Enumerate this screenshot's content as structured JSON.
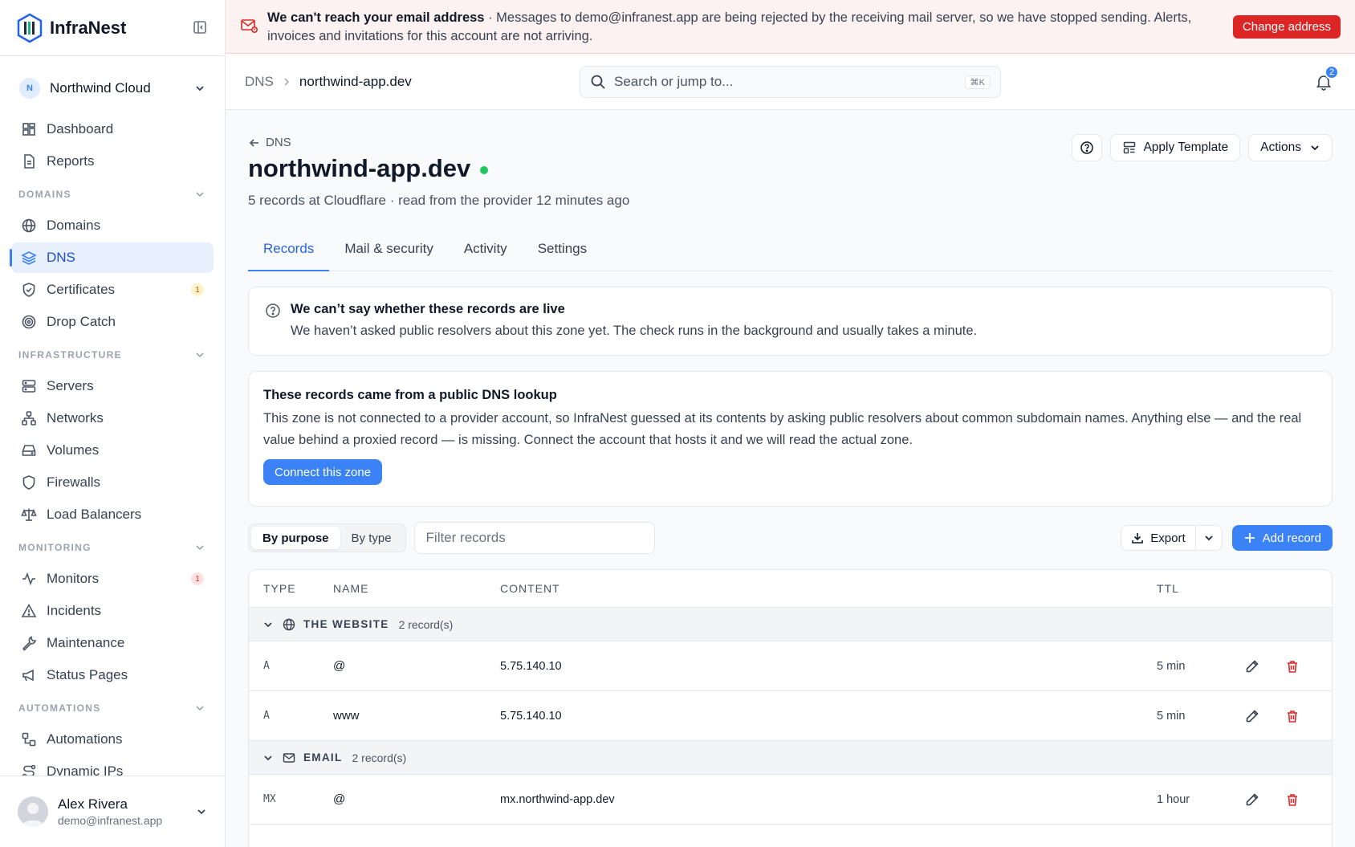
{
  "brand": {
    "name": "InfraNest"
  },
  "org": {
    "initial": "N",
    "name": "Northwind Cloud"
  },
  "sidebar": {
    "top_items": [
      {
        "label": "Dashboard"
      },
      {
        "label": "Reports"
      }
    ],
    "sections": [
      {
        "title": "DOMAINS",
        "items": [
          {
            "label": "Domains"
          },
          {
            "label": "DNS",
            "active": true
          },
          {
            "label": "Certificates",
            "badge": "1"
          },
          {
            "label": "Drop Catch"
          }
        ]
      },
      {
        "title": "INFRASTRUCTURE",
        "items": [
          {
            "label": "Servers"
          },
          {
            "label": "Networks"
          },
          {
            "label": "Volumes"
          },
          {
            "label": "Firewalls"
          },
          {
            "label": "Load Balancers"
          }
        ]
      },
      {
        "title": "MONITORING",
        "items": [
          {
            "label": "Monitors",
            "badge": "1"
          },
          {
            "label": "Incidents"
          },
          {
            "label": "Maintenance"
          },
          {
            "label": "Status Pages"
          }
        ]
      },
      {
        "title": "AUTOMATIONS",
        "items": [
          {
            "label": "Automations"
          },
          {
            "label": "Dynamic IPs"
          }
        ]
      }
    ]
  },
  "user": {
    "name": "Alex Rivera",
    "email": "demo@infranest.app"
  },
  "banner": {
    "title": "We can't reach your email address",
    "separator": " · ",
    "message": "Messages to demo@infranest.app are being rejected by the receiving mail server, so we have stopped sending. Alerts, invoices and invitations for this account are not arriving.",
    "button": "Change address",
    "color": "#dc2626"
  },
  "topbar": {
    "breadcrumb_root": "DNS",
    "breadcrumb_current": "northwind-app.dev",
    "search_placeholder": "Search or jump to...",
    "search_shortcut": "⌘K",
    "notifications": "2"
  },
  "page": {
    "back_label": "DNS",
    "title": "northwind-app.dev",
    "subtitle": "5 records at Cloudflare · read from the provider 12 minutes ago",
    "apply_template": "Apply Template",
    "actions": "Actions",
    "status_color": "#22c55e"
  },
  "tabs": [
    {
      "label": "Records",
      "active": true
    },
    {
      "label": "Mail & security"
    },
    {
      "label": "Activity"
    },
    {
      "label": "Settings"
    }
  ],
  "live_notice": {
    "title": "We can’t say whether these records are live",
    "text": "We haven’t asked public resolvers about this zone yet. The check runs in the background and usually takes a minute."
  },
  "lookup_notice": {
    "title": "These records came from a public DNS lookup",
    "text": "This zone is not connected to a provider account, so InfraNest guessed at its contents by asking public resolvers about common subdomain names. Anything else — and the real value behind a proxied record — is missing. Connect the account that hosts it and we will read the actual zone.",
    "button": "Connect this zone"
  },
  "toolbar": {
    "view_purpose": "By purpose",
    "view_type": "By type",
    "filter_placeholder": "Filter records",
    "export": "Export",
    "add": "Add record",
    "accent": "#3b82f6"
  },
  "table": {
    "headers": {
      "type": "TYPE",
      "name": "NAME",
      "content": "CONTENT",
      "ttl": "TTL"
    },
    "groups": [
      {
        "label": "THE WEBSITE",
        "count": "2 record(s)",
        "icon": "globe-icon",
        "records": [
          {
            "type": "A",
            "name": "@",
            "content": "5.75.140.10",
            "ttl": "5 min"
          },
          {
            "type": "A",
            "name": "www",
            "content": "5.75.140.10",
            "ttl": "5 min"
          }
        ]
      },
      {
        "label": "EMAIL",
        "count": "2 record(s)",
        "icon": "mail-icon",
        "records": [
          {
            "type": "MX",
            "name": "@",
            "content": "mx.northwind-app.dev",
            "ttl": "1 hour"
          },
          {
            "type": "",
            "name": "",
            "content": "",
            "ttl": ""
          }
        ]
      }
    ]
  }
}
